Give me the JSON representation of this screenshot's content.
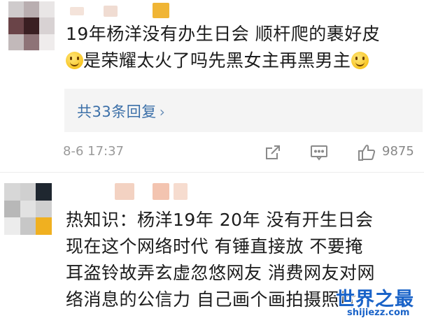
{
  "comment1": {
    "line1": "19年杨洋没有办生日会 顺杆爬的裹好皮",
    "line2": "是荣耀太火了吗先黑女主再黑男主",
    "reply_link": "共33条回复",
    "reply_chevron": "›",
    "timestamp": "8-6 17:37",
    "likes": "9875"
  },
  "comment2": {
    "line1": "热知识：杨洋19年 20年 没有开生日会",
    "line2": "现在这个网络时代 有锤直接放 不要掩",
    "line3": "耳盗铃故弄玄虚忽悠网友 消费网友对网",
    "line4": "络消息的公信力 自己画个画拍摄照片"
  },
  "watermark": {
    "title": "世界之最",
    "url": "shijiezz.com"
  },
  "colors": {
    "link": "#3b6fa8",
    "meta": "#9a9a9a",
    "reply_bg": "#f4f4f4",
    "watermark": "#1a63c8"
  }
}
